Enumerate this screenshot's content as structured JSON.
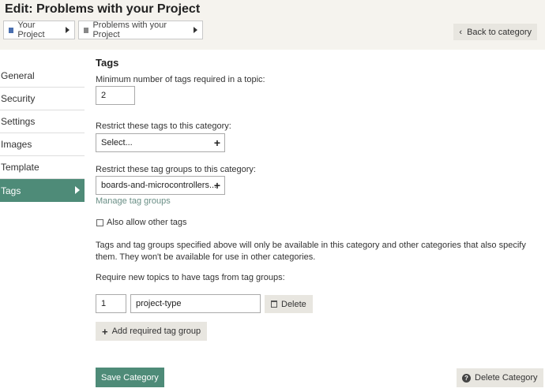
{
  "header": {
    "title": "Edit: Problems with your Project",
    "breadcrumbs": [
      {
        "label": "Your Project",
        "color": "#4a6fb0"
      },
      {
        "label": "Problems with your Project",
        "color": "#888888"
      }
    ],
    "back_label": "Back to category"
  },
  "sidebar": {
    "items": [
      {
        "label": "General"
      },
      {
        "label": "Security"
      },
      {
        "label": "Settings"
      },
      {
        "label": "Images"
      },
      {
        "label": "Template"
      },
      {
        "label": "Tags",
        "active": true
      }
    ]
  },
  "tags": {
    "title": "Tags",
    "min_label": "Minimum number of tags required in a topic:",
    "min_value": "2",
    "restrict_tags_label": "Restrict these tags to this category:",
    "restrict_tags_placeholder": "Select...",
    "restrict_groups_label": "Restrict these tag groups to this category:",
    "restrict_groups_value": "boards-and-microcontrollers...",
    "manage_link": "Manage tag groups",
    "allow_other_label": "Also allow other tags",
    "allow_other_checked": false,
    "description": "Tags and tag groups specified above will only be available in this category and other categories that also specify them. They won't be available for use in other categories.",
    "require_label": "Require new topics to have tags from tag groups:",
    "required_groups": [
      {
        "count": "1",
        "group": "project-type",
        "delete_label": "Delete"
      }
    ],
    "add_group_label": "Add required tag group"
  },
  "footer": {
    "save_label": "Save Category",
    "delete_label": "Delete Category"
  },
  "colors": {
    "accent": "#4e8b78",
    "header_bg": "#f5f3ee",
    "link": "#6a8f86"
  }
}
